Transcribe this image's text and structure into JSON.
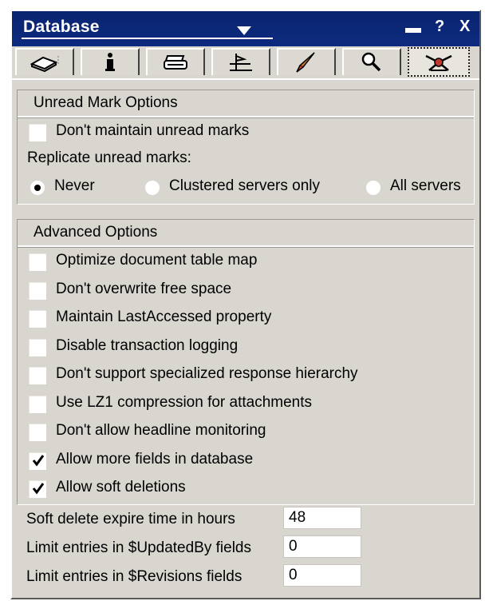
{
  "titlebar": {
    "title": "Database",
    "minimize_label": "▬",
    "help_label": "?",
    "close_label": "X"
  },
  "tabs": [
    {
      "icon": "book-icon"
    },
    {
      "icon": "info-icon"
    },
    {
      "icon": "printer-icon"
    },
    {
      "icon": "design-icon"
    },
    {
      "icon": "launch-icon"
    },
    {
      "icon": "magnifier-icon"
    },
    {
      "icon": "advanced-propeller-icon",
      "active": true
    }
  ],
  "unread": {
    "title": "Unread Mark Options",
    "dont_maintain": {
      "label": "Don't maintain unread marks",
      "checked": false
    },
    "replicate_label": "Replicate unread marks:",
    "options": [
      {
        "label": "Never",
        "selected": true
      },
      {
        "label": "Clustered servers only",
        "selected": false
      },
      {
        "label": "All servers",
        "selected": false
      }
    ]
  },
  "advanced": {
    "title": "Advanced Options",
    "checkboxes": [
      {
        "label": "Optimize document table map",
        "checked": false
      },
      {
        "label": "Don't overwrite free space",
        "checked": false
      },
      {
        "label": "Maintain LastAccessed property",
        "checked": false
      },
      {
        "label": "Disable transaction logging",
        "checked": false
      },
      {
        "label": "Don't support specialized response hierarchy",
        "checked": false
      },
      {
        "label": "Use LZ1 compression for attachments",
        "checked": false
      },
      {
        "label": "Don't allow headline monitoring",
        "checked": false
      },
      {
        "label": "Allow more fields in database",
        "checked": true
      },
      {
        "label": "Allow soft deletions",
        "checked": true
      }
    ],
    "fields": [
      {
        "label": "Soft delete expire time in hours",
        "value": "48"
      },
      {
        "label": "Limit entries in $UpdatedBy fields",
        "value": "0"
      },
      {
        "label": "Limit entries in $Revisions fields",
        "value": "0"
      }
    ]
  }
}
